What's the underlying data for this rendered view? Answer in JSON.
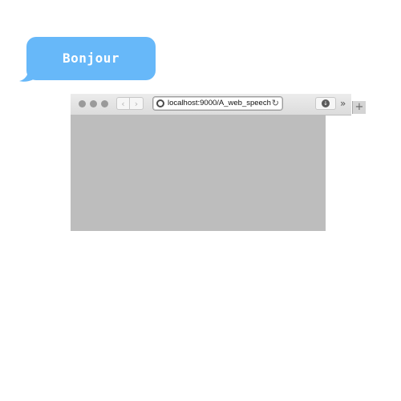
{
  "bubble": {
    "text": "Bonjour",
    "color": "#67b8f9"
  },
  "browser": {
    "nav": {
      "back_icon": "chevron-left-icon",
      "forward_icon": "chevron-right-icon",
      "back_glyph": "‹",
      "forward_glyph": "›"
    },
    "address": {
      "site_icon": "site-globe-icon",
      "url": "localhost:9000/A_web_speech",
      "reload_icon": "reload-icon",
      "reload_glyph": "↻"
    },
    "toolbar": {
      "download_icon": "download-icon",
      "download_glyph": "↓",
      "overflow_icon": "double-chevron-icon",
      "overflow_glyph": "»",
      "new_tab_icon": "plus-icon",
      "new_tab_glyph": "+"
    },
    "content_color": "#bdbdbd"
  }
}
